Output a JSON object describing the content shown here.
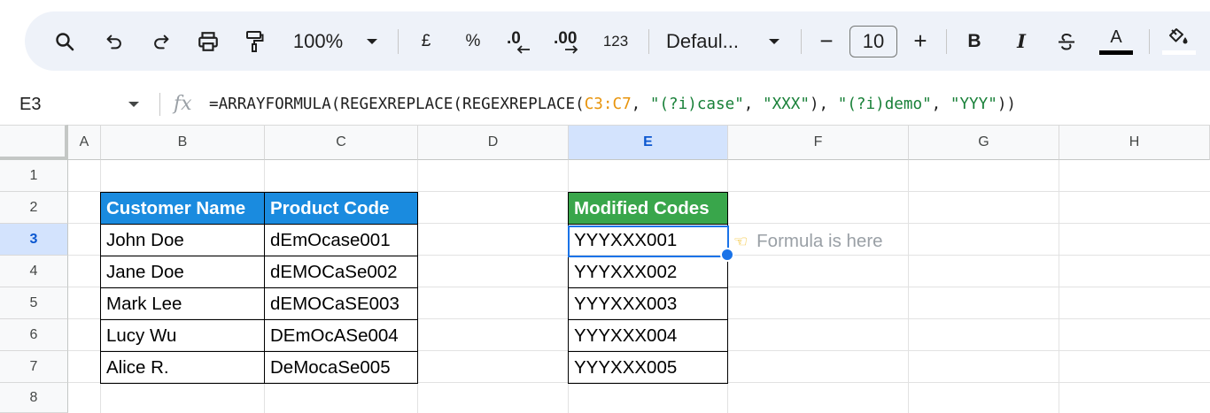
{
  "toolbar": {
    "zoom": "100%",
    "currency_label": "£",
    "percent_label": "%",
    "decrease_decimal_label": ".0",
    "increase_decimal_label": ".00",
    "number_format_label": "123",
    "font_family": "Defaul...",
    "font_size": "10",
    "decrease_font_label": "−",
    "increase_font_label": "+",
    "bold_label": "B",
    "italic_label": "I",
    "text_color_label": "A",
    "text_color_bar": "#000000"
  },
  "formula_bar": {
    "name_box": "E3",
    "fx_label": "fx",
    "formula_prefix": "=ARRAYFORMULA(REGEXREPLACE(REGEXREPLACE(",
    "formula_ref": "C3:C7",
    "formula_sep1": ", ",
    "formula_str1": "\"(?i)case\"",
    "formula_sep2": ", ",
    "formula_str2": "\"XXX\"",
    "formula_sep3": "), ",
    "formula_str3": "\"(?i)demo\"",
    "formula_sep4": ", ",
    "formula_str4": "\"YYY\"",
    "formula_suffix": "))"
  },
  "sheet": {
    "columns": [
      "A",
      "B",
      "C",
      "D",
      "E",
      "F",
      "G",
      "H"
    ],
    "rows": [
      "1",
      "2",
      "3",
      "4",
      "5",
      "6",
      "7",
      "8"
    ],
    "table1_headers": [
      "Customer Name",
      "Product Code"
    ],
    "table1_rows": [
      [
        "John Doe",
        "dEmOcase001"
      ],
      [
        "Jane Doe",
        "dEMOCaSe002"
      ],
      [
        "Mark Lee",
        "dEMOCaSE003"
      ],
      [
        "Lucy Wu",
        "DEmOcASe004"
      ],
      [
        "Alice R.",
        "DeMocaSe005"
      ]
    ],
    "table2_header": "Modified Codes",
    "table2_rows": [
      "YYYXXX001",
      "YYYXXX002",
      "YYYXXX003",
      "YYYXXX004",
      "YYYXXX005"
    ],
    "note": "Formula is here"
  },
  "colors": {
    "header_blue": "#1a8bdf",
    "header_green": "#39a64b",
    "selection": "#1a73e8",
    "formula_ref": "#e8940c",
    "formula_string": "#188038"
  }
}
